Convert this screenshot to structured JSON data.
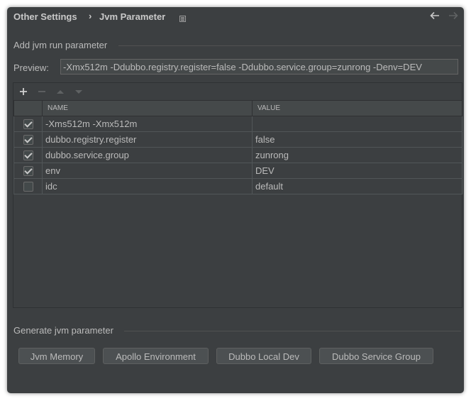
{
  "header": {
    "breadcrumb_parent": "Other Settings",
    "breadcrumb_separator": "›",
    "breadcrumb_current": "Jvm Parameter"
  },
  "add_section": {
    "title": "Add jvm run parameter",
    "preview_label": "Preview:",
    "preview_value": "-Xmx512m -Ddubbo.registry.register=false -Ddubbo.service.group=zunrong -Denv=DEV"
  },
  "toolbar": {
    "add_symbol": "+",
    "remove_symbol": "−"
  },
  "table": {
    "columns": [
      "NAME",
      "VALUE"
    ],
    "rows": [
      {
        "checked": true,
        "name": "-Xms512m -Xmx512m",
        "value": ""
      },
      {
        "checked": true,
        "name": "dubbo.registry.register",
        "value": "false"
      },
      {
        "checked": true,
        "name": "dubbo.service.group",
        "value": "zunrong"
      },
      {
        "checked": true,
        "name": "env",
        "value": "DEV"
      },
      {
        "checked": false,
        "name": "idc",
        "value": "default"
      }
    ]
  },
  "generate_section": {
    "title": "Generate jvm parameter",
    "buttons": [
      "Jvm Memory",
      "Apollo Environment",
      "Dubbo Local Dev",
      "Dubbo Service Group"
    ]
  },
  "colors": {
    "background": "#3c3f41",
    "field": "#45494a",
    "text": "#bbbbbb"
  }
}
